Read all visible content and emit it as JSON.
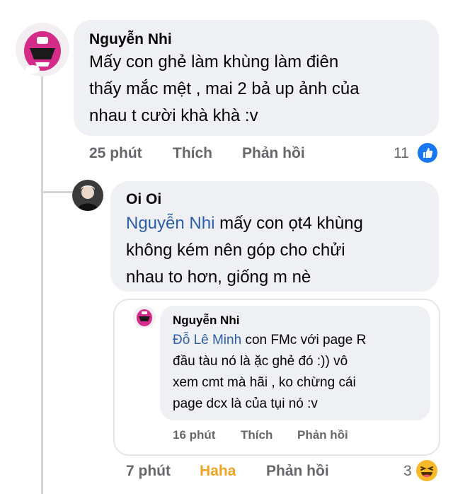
{
  "comment1": {
    "author": "Nguyễn Nhi",
    "lines": [
      "Mấy con ghẻ làm khùng làm điên",
      "thấy mắc mệt , mai 2 bả up ảnh của",
      "nhau t cười khà khà :v"
    ],
    "time": "25 phút",
    "like_label": "Thích",
    "reply_label": "Phản hồi",
    "reaction_count": "11",
    "reaction_icon": "like-icon",
    "colors": {
      "like": "#1877f2"
    }
  },
  "reply1": {
    "author": "Oi Oi",
    "tag": "Nguyễn Nhi",
    "line1_rest": " mấy con ọt4 khùng",
    "line2": "không kém nên góp cho chửi",
    "line3": "nhau to hơn, giống m nè",
    "time": "7 phút",
    "reaction_label": "Haha",
    "reply_label": "Phản hồi",
    "reaction_count": "3",
    "reaction_icon": "haha-icon",
    "colors": {
      "haha": "#f0a326"
    }
  },
  "quoted": {
    "author": "Nguyễn Nhi",
    "tag": "Đỗ Lê Minh",
    "line1_rest": " con FMc với page R",
    "line2": "đầu tàu nó là ặc ghẻ đó :)) vô",
    "line3": "xem cmt mà hãi , ko chừng cái",
    "line4": "page dcx là của tụi nó :v",
    "time": "16 phút",
    "like_label": "Thích",
    "reply_label": "Phản hồi"
  }
}
